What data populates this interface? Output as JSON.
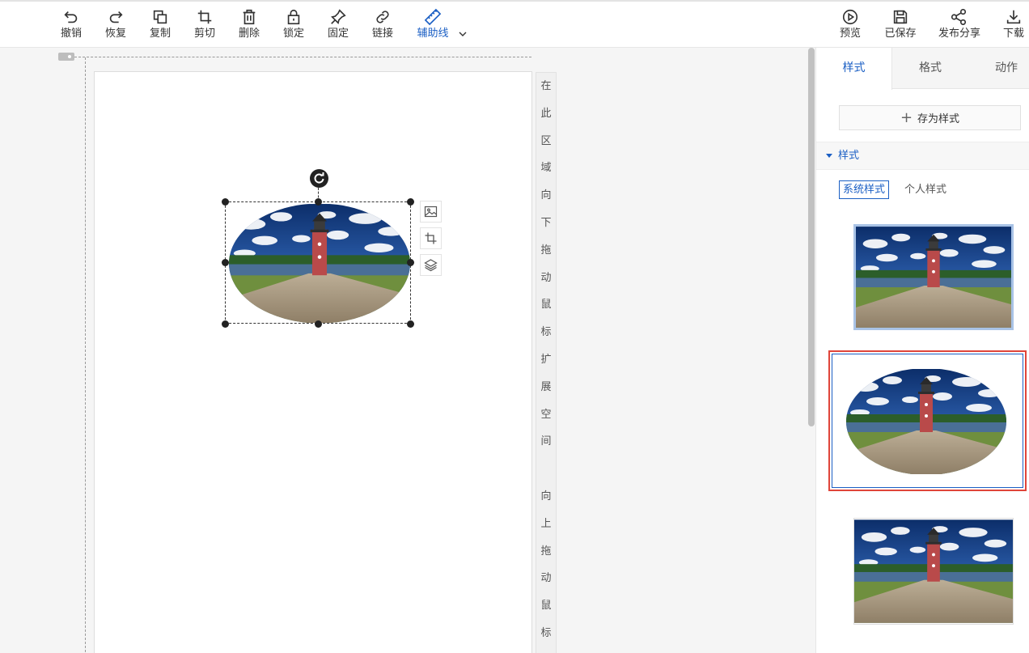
{
  "toolbar": {
    "undo": "撤销",
    "redo": "恢复",
    "copy": "复制",
    "cut": "剪切",
    "delete": "删除",
    "lock": "锁定",
    "pin": "固定",
    "link": "链接",
    "guides": "辅助线",
    "preview": "预览",
    "saved": "已保存",
    "publish": "发布分享",
    "download": "下载"
  },
  "canvas": {
    "hint_chars": [
      "在",
      "此",
      "区",
      "域",
      "向",
      "下",
      "拖",
      "动",
      "鼠",
      "标",
      "扩",
      "展",
      "空",
      "间",
      "",
      "向",
      "上",
      "拖",
      "动",
      "鼠",
      "标"
    ]
  },
  "panel": {
    "tabs": [
      "样式",
      "格式",
      "动作"
    ],
    "save_style": "存为样式",
    "section_title": "样式",
    "subtabs": [
      "系统样式",
      "个人样式"
    ]
  },
  "colors": {
    "accent": "#1b5fc4",
    "highlight": "#e0453a"
  }
}
